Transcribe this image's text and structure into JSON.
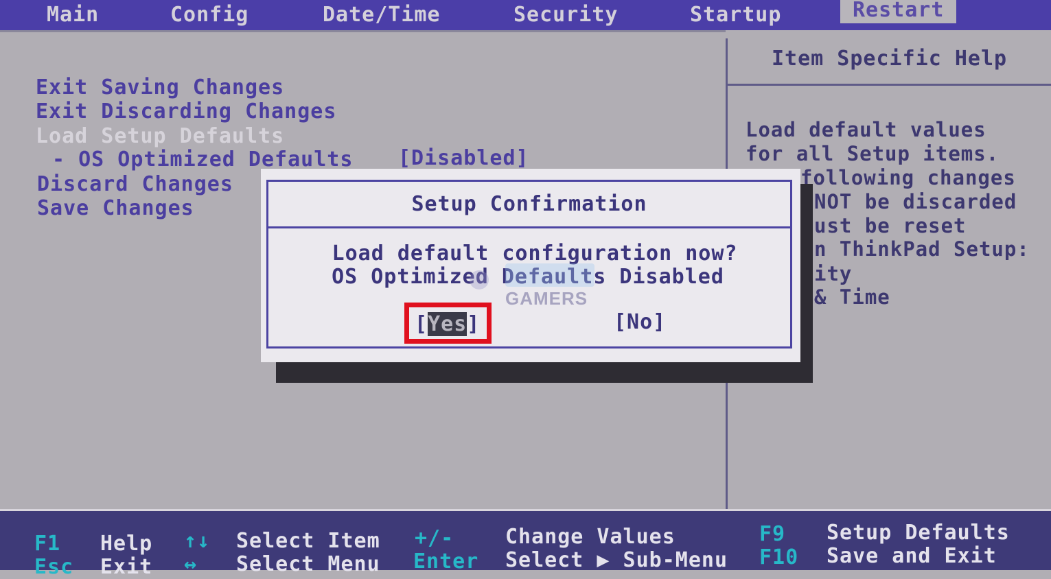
{
  "tabs": [
    {
      "label": "Main"
    },
    {
      "label": "Config"
    },
    {
      "label": "Date/Time"
    },
    {
      "label": "Security"
    },
    {
      "label": "Startup"
    },
    {
      "label": "Restart"
    }
  ],
  "active_tab": "Restart",
  "menu": {
    "exit_saving": "Exit Saving Changes",
    "exit_discarding": "Exit Discarding Changes",
    "load_defaults": "Load Setup Defaults",
    "os_optimized_label": "- OS Optimized Defaults",
    "os_optimized_value": "[Disabled]",
    "discard_changes": "Discard Changes",
    "save_changes": "Save Changes"
  },
  "help": {
    "title": "Item Specific Help",
    "lines": [
      "Load default values",
      "for all Setup items.",
      "following changes",
      "NOT be discarded",
      "ust be reset",
      "n ThinkPad Setup:",
      "ity",
      "& Time"
    ]
  },
  "dialog": {
    "title": "Setup Confirmation",
    "line1": "Load default configuration now?",
    "line2": "OS Optimized Defaults Disabled",
    "yes_open": "[",
    "yes_label": "Yes",
    "yes_close": "]",
    "no_label": "[No]"
  },
  "watermark": {
    "text": "GAMERS"
  },
  "footer": {
    "f1_key": "F1",
    "f1_desc": "Help",
    "esc_key": "Esc",
    "esc_desc": "Exit",
    "updown_key": "↑↓",
    "updown_desc": "Select Item",
    "leftright_key": "↔",
    "leftright_desc": "Select Menu",
    "plusminus_key": "+/-",
    "plusminus_desc": "Change Values",
    "enter_key": "Enter",
    "enter_desc": "Select ▶ Sub-Menu",
    "f9_key": "F9",
    "f9_desc": "Setup Defaults",
    "f10_key": "F10",
    "f10_desc": "Save and Exit"
  },
  "colors": {
    "topbar": "#4b3ea8",
    "background": "#b1aeb4",
    "menu_text": "#4b3ea0",
    "highlight_box": "#e0101e",
    "footer": "#3e3a78",
    "footer_key": "#27b8c8"
  }
}
